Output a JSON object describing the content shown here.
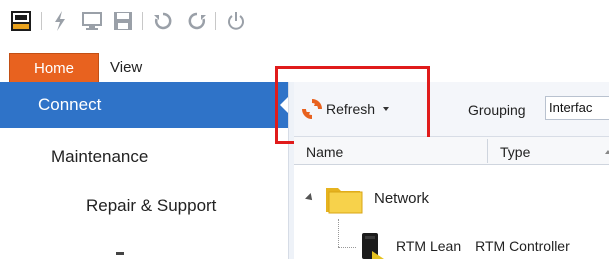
{
  "app": {
    "quick_access": [
      {
        "icon": "app-logo-icon"
      },
      {
        "icon": "flash-icon"
      },
      {
        "icon": "monitor-icon"
      },
      {
        "icon": "save-icon"
      },
      {
        "icon": "undo-refresh-icon"
      },
      {
        "icon": "refresh-icon"
      },
      {
        "icon": "power-icon"
      }
    ],
    "tabs": {
      "home": "Home",
      "view": "View"
    }
  },
  "sidebar": {
    "items": [
      {
        "label": "Connect",
        "selected": true
      },
      {
        "label": "Maintenance"
      },
      {
        "label": "Repair & Support"
      }
    ]
  },
  "toolbar": {
    "refresh_label": "Refresh",
    "grouping_label": "Grouping",
    "grouping_value": "Interfac"
  },
  "grid": {
    "columns": [
      "Name",
      "Type"
    ],
    "rows": [
      {
        "name": "Network",
        "type": ""
      },
      {
        "name": "RTM Lean",
        "type": "RTM Controller"
      }
    ]
  },
  "colors": {
    "accent_orange": "#e8621f",
    "selection_blue": "#2f73c8",
    "highlight_red": "#e01b1b"
  }
}
